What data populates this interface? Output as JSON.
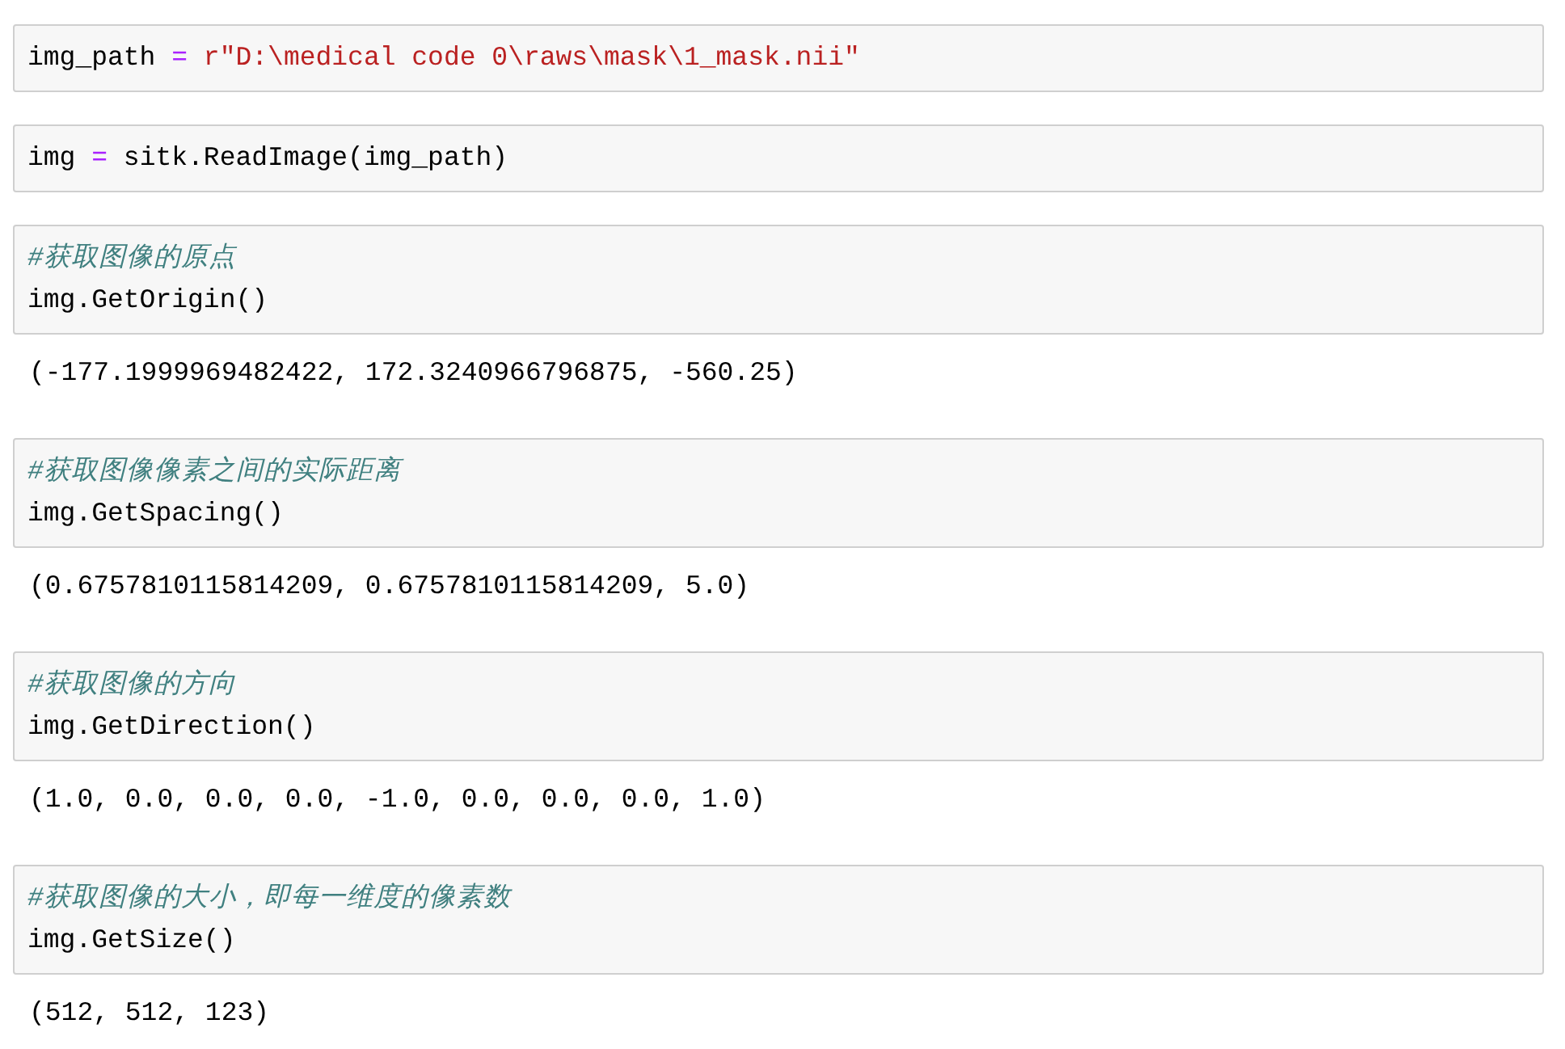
{
  "cells": [
    {
      "lines": [
        [
          {
            "kind": "name",
            "text": "img_path "
          },
          {
            "kind": "operator",
            "text": "="
          },
          {
            "kind": "string",
            "text": " r\"D:\\medical code 0\\raws\\mask\\1_mask.nii\""
          }
        ]
      ]
    },
    {
      "lines": [
        [
          {
            "kind": "name",
            "text": "img "
          },
          {
            "kind": "operator",
            "text": "="
          },
          {
            "kind": "name",
            "text": " sitk.ReadImage(img_path)"
          }
        ]
      ]
    },
    {
      "lines": [
        [
          {
            "kind": "comment",
            "text": "#获取图像的原点"
          }
        ],
        [
          {
            "kind": "name",
            "text": "img.GetOrigin()"
          }
        ]
      ],
      "output": "(-177.1999969482422, 172.3240966796875, -560.25)"
    },
    {
      "lines": [
        [
          {
            "kind": "comment",
            "text": "#获取图像像素之间的实际距离"
          }
        ],
        [
          {
            "kind": "name",
            "text": "img.GetSpacing()"
          }
        ]
      ],
      "output": "(0.6757810115814209, 0.6757810115814209, 5.0)"
    },
    {
      "lines": [
        [
          {
            "kind": "comment",
            "text": "#获取图像的方向"
          }
        ],
        [
          {
            "kind": "name",
            "text": "img.GetDirection()"
          }
        ]
      ],
      "output": "(1.0, 0.0, 0.0, 0.0, -1.0, 0.0, 0.0, 0.0, 1.0)"
    },
    {
      "lines": [
        [
          {
            "kind": "comment",
            "text": "#获取图像的大小，即每一维度的像素数"
          }
        ],
        [
          {
            "kind": "name",
            "text": "img.GetSize()"
          }
        ]
      ],
      "output": "(512, 512, 123)"
    }
  ]
}
